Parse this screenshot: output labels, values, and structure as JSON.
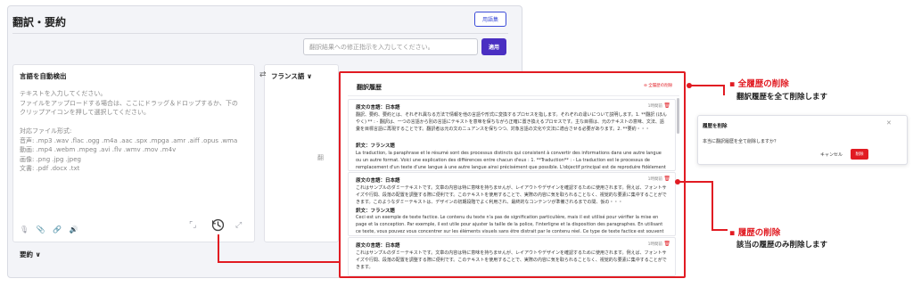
{
  "app": {
    "title": "翻訳・要約",
    "glossary_button": "用語集",
    "instruction_placeholder": "翻訳結果への修正指示を入力してください。",
    "apply_button": "適用",
    "source_lang": "言語を自動検出",
    "target_lang": "フランス語 ∨",
    "source_placeholder": "テキストを入力してください。\nファイルをアップロードする場合は、ここにドラッグ＆ドロップするか、下の\nクリップアイコンを押して選択してください。\n\n対応ファイル形式:\n音声: .mp3 .wav .flac .ogg .m4a .aac .spx .mpga .amr .aiff .opus .wma\n動画: .mp4 .webm .mpeg .avi .flv .wmv .mov .m4v\n画像: .png .jpg .jpeg\n文書: .pdf .docx .txt",
    "target_fragment": "翻",
    "summary_label": "要約 ∨"
  },
  "history": {
    "title": "翻訳履歴",
    "delete_all": "全履歴の削除",
    "entries": [
      {
        "source_label": "原文の言語：日本語",
        "time": "1時間前",
        "source_text": "翻訳、要約、要約とは、それぞれ異なる方法で情報を他の言語や形式に変換するプロセスを指します。それぞれの違いについて説明します。1. **翻訳 (ほんやく) ** : - 翻訳は、一つの言語から別の言語にテキストを意味を保ちながら正確に置き換えるプロセスです。主な目標は、元のテキストの意味、文法、語彙を目標言語に再現することです。翻訳者は元の文のニュアンスを保ちつつ、対象言語の文化や文法に適合させる必要があります。2. **要約・・・",
        "trans_label": "訳文：フランス語",
        "trans_text": "La traduction, la paraphrase et le résumé sont des processus distincts qui consistent à convertir des informations dans une autre langue ou un autre format. Voici une explication des différences entre chacun d'eux : 1. **Traduction** : - La traduction est le processus de remplacement d'un texte d'une langue à une autre langue ainsi précisément que possible. L'objectif principal est de reproduire fidèlement le sens, la grammaire et・・・"
      },
      {
        "source_label": "原文の言語：日本語",
        "time": "1時間前",
        "source_text": "これはサンプルのダミーテキストです。文章の内容は特に意味を持ちませんが、レイアウトやデザインを確認するために使用されます。例えば、フォントサイズや行間、段落の配置を調整する際に便利です。このテキストを使用することで、実際の内容に気を取られることなく、視覚的な要素に集中することができます。このようなダミーテキストは、デザインの初期段階でよく利用され、最終的なコンテンツが準備されるまでの間、仮の・・・",
        "trans_label": "訳文：フランス語",
        "trans_text": "Ceci est un exemple de texte factice. Le contenu du texte n'a pas de signification particulière, mais il est utilisé pour vérifier la mise en page et la conception. Par exemple, il est utile pour ajuster la taille de la police, l'interligne et la disposition des paragraphes. En utilisant ce texte, vous pouvez vous concentrer sur les éléments visuels sans être distrait par le contenu réel. Ce type de texte factice est souvent utilisé au début de l・・・"
      },
      {
        "source_label": "原文の言語：日本語",
        "time": "1時間前",
        "source_text": "これはサンプルのダミーテキストです。文章の内容は特に意味を持ちませんが、レイアウトやデザインを確認するために使用されます。例えば、フォントサイズや行間、段落の配置を調整する際に便利です。このテキストを使用することで、実際の内容に気を取られることなく、視覚的な要素に集中することができます。",
        "trans_label": "",
        "trans_text": ""
      }
    ]
  },
  "annotations": {
    "delete_all_title": "▪ 全履歴の削除",
    "delete_all_desc": "翻訳履歴を全て削除します",
    "delete_one_title": "▪ 履歴の削除",
    "delete_one_desc": "該当の履歴のみ削除します"
  },
  "dialog": {
    "title": "履歴を削除",
    "message": "本当に翻訳履歴を全て削除しますか？",
    "cancel": "キャンセル",
    "delete": "削除"
  },
  "colors": {
    "accent_red": "#e11b22",
    "primary": "#4a2fc2",
    "glossary_blue": "#3b4bd8"
  }
}
